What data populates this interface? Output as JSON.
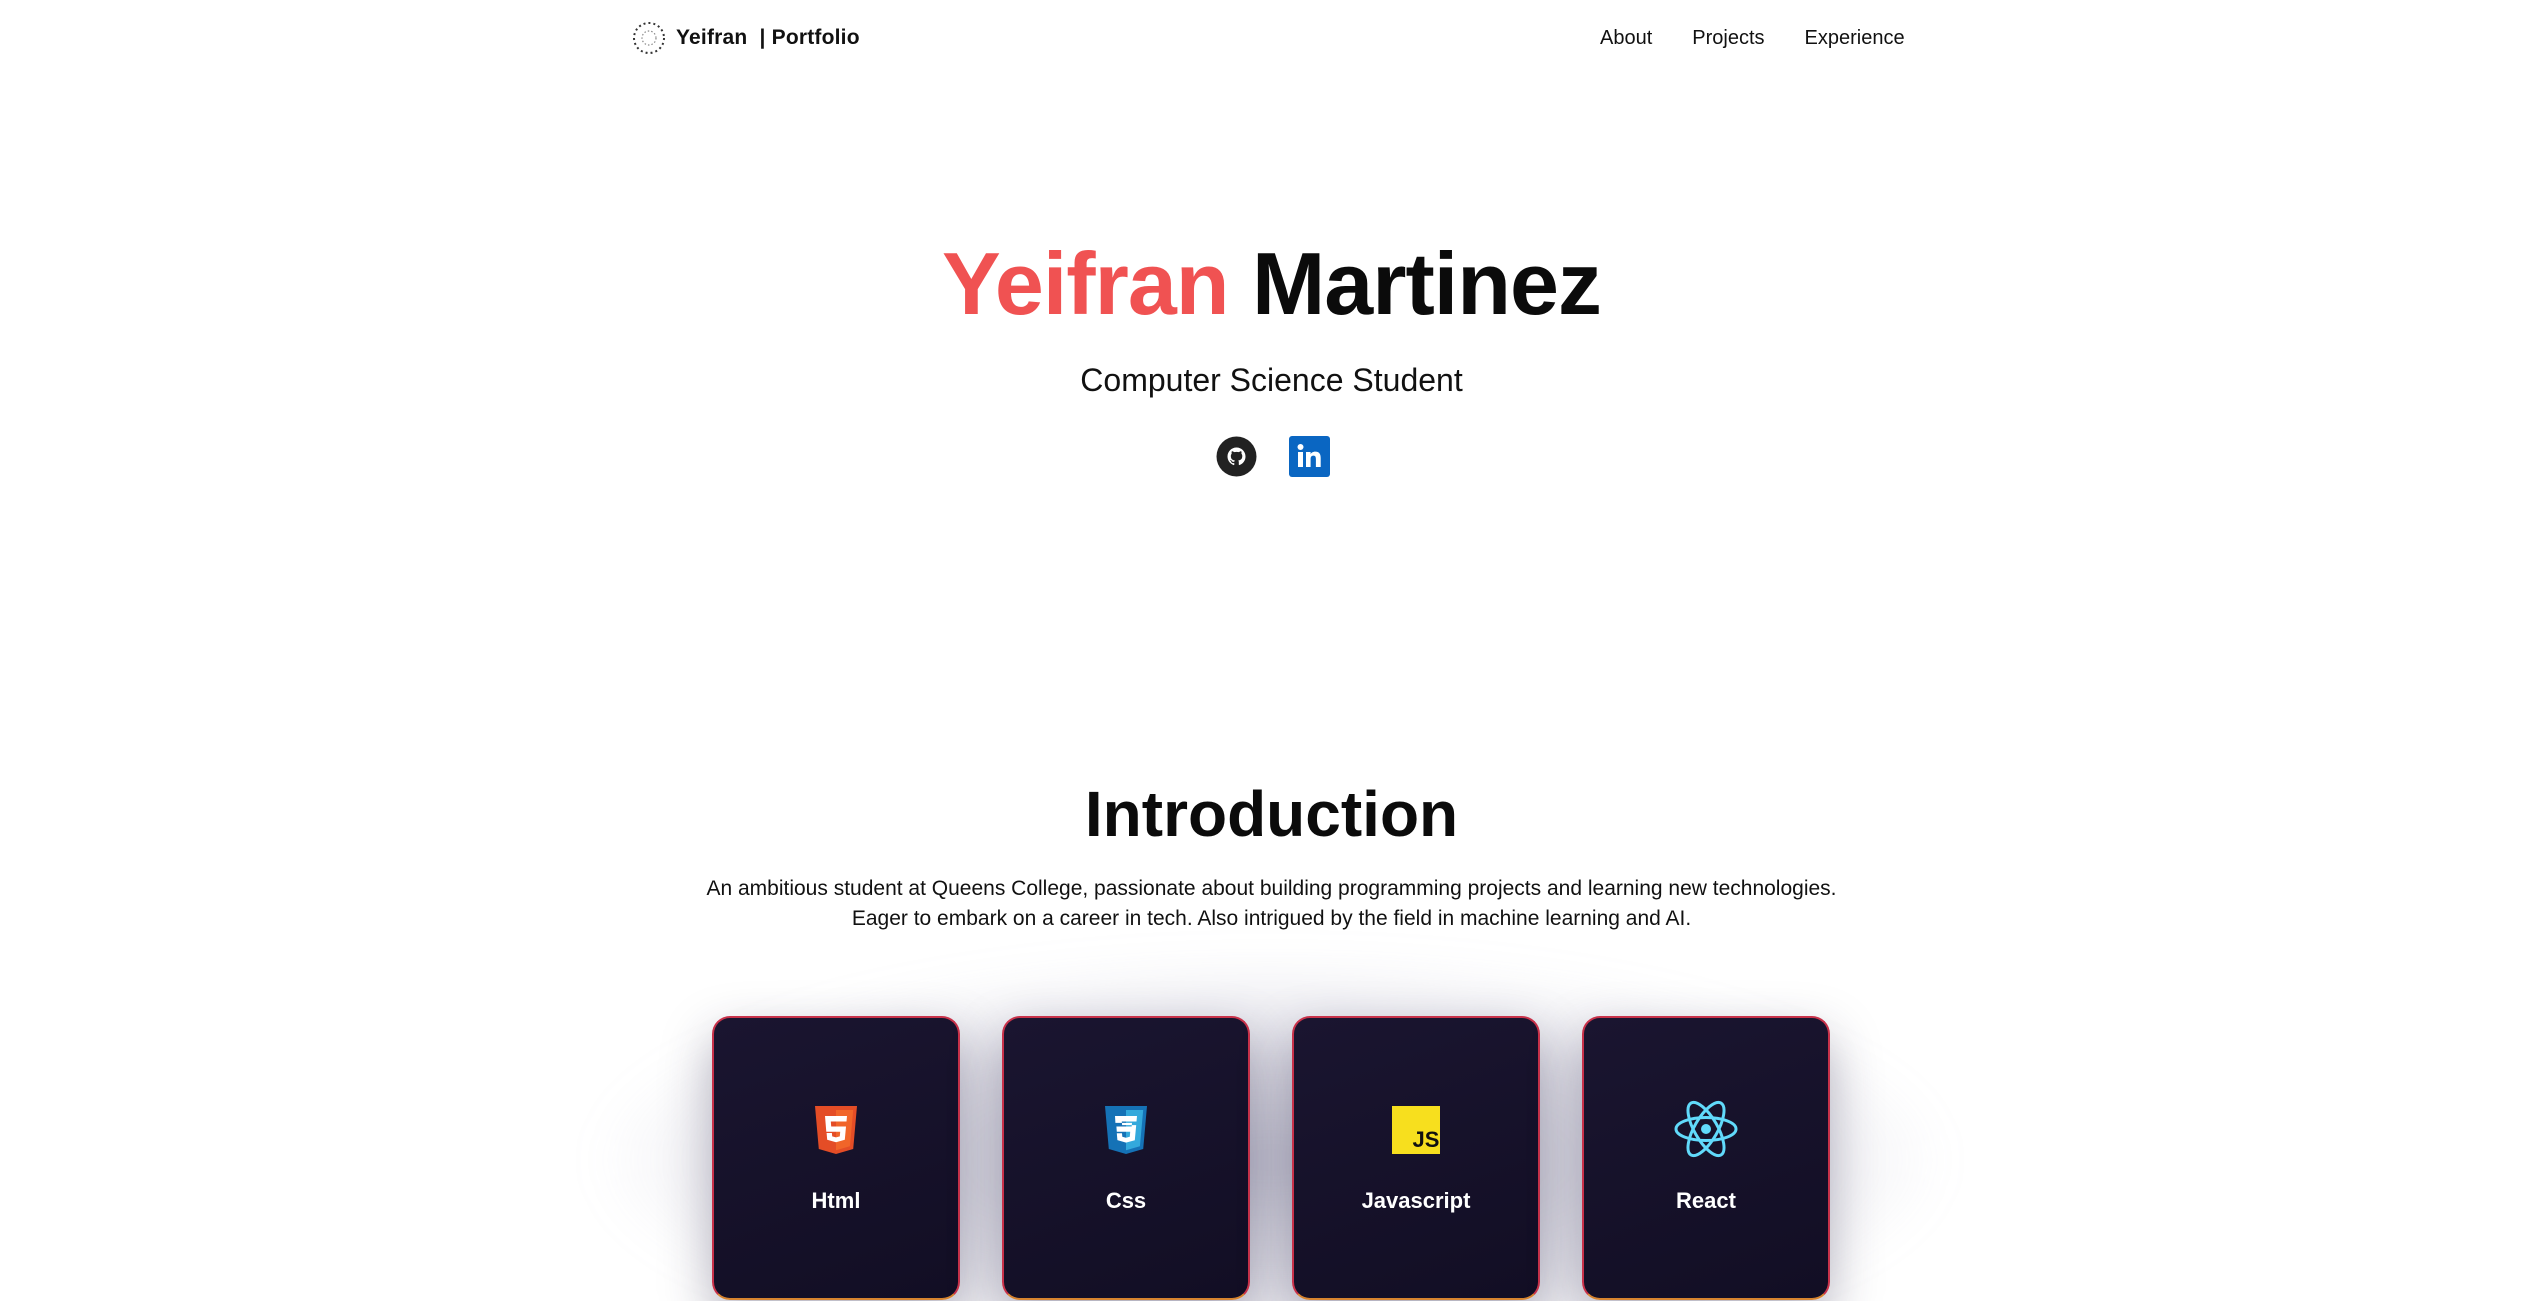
{
  "navbar": {
    "brand": {
      "logo_icon": "dotted-circle-logo-icon",
      "text": "Yeifran  | Portfolio"
    },
    "links": [
      {
        "label": "About"
      },
      {
        "label": "Projects"
      },
      {
        "label": "Experience"
      }
    ]
  },
  "hero": {
    "first_name": "Yeifran",
    "last_name": "Martinez",
    "subtitle": "Computer Science Student",
    "socials": [
      {
        "icon": "github-icon",
        "color": "#222222"
      },
      {
        "icon": "linkedin-icon",
        "color": "#0a66c2"
      }
    ]
  },
  "intro": {
    "title": "Introduction",
    "text": "An ambitious student at Queens College, passionate about building programming projects and learning new technologies. Eager to embark on a career in tech. Also intrigued by the field in machine learning and AI."
  },
  "skills": [
    {
      "label": "Html",
      "icon": "html5-icon",
      "color": "#e44d26"
    },
    {
      "label": "Css",
      "icon": "css3-icon",
      "color": "#1572b6"
    },
    {
      "label": "Javascript",
      "icon": "javascript-icon",
      "color": "#f7df1e"
    },
    {
      "label": "React",
      "icon": "react-icon",
      "color": "#61dafb"
    }
  ],
  "colors": {
    "accent": "#f05252",
    "card_background": "#140f28",
    "card_border": "#c8324a"
  }
}
